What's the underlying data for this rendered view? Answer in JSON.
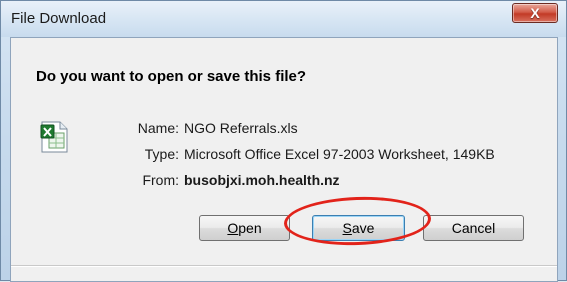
{
  "window": {
    "title": "File Download"
  },
  "dialog": {
    "heading": "Do you want to open or save this file?",
    "file": {
      "name_label": "Name:",
      "name_value": "NGO Referrals.xls",
      "type_label": "Type:",
      "type_value": "Microsoft Office Excel 97-2003 Worksheet, 149KB",
      "from_label": "From:",
      "from_value": "busobjxi.moh.health.nz",
      "icon": "excel-file-icon"
    },
    "buttons": {
      "open_mnemonic": "O",
      "open_rest": "pen",
      "save_mnemonic": "S",
      "save_rest": "ave",
      "cancel": "Cancel"
    }
  },
  "close_symbol": "X",
  "colors": {
    "highlight": "#e2231a",
    "close_button": "#c23a26",
    "default_button_border": "#3c7fb1"
  }
}
